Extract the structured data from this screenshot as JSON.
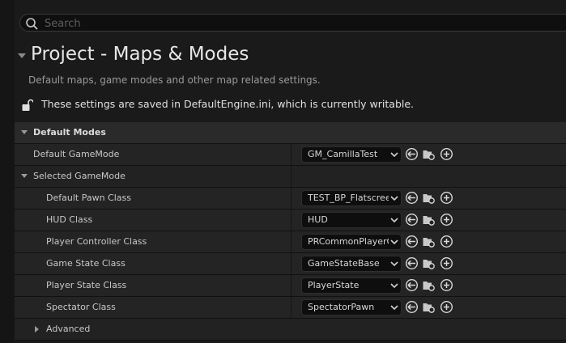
{
  "search": {
    "placeholder": "Search"
  },
  "header": {
    "title": "Project - Maps & Modes",
    "subtitle": "Default maps, game modes and other map related settings.",
    "config_notice": "These settings are saved in DefaultEngine.ini, which is currently writable."
  },
  "section": {
    "label": "Default Modes"
  },
  "default_gamemode": {
    "label": "Default GameMode",
    "value": "GM_CamillaTest"
  },
  "selected_gamemode": {
    "label": "Selected GameMode"
  },
  "properties": [
    {
      "label": "Default Pawn Class",
      "value": "TEST_BP_Flatscreen"
    },
    {
      "label": "HUD Class",
      "value": "HUD"
    },
    {
      "label": "Player Controller Class",
      "value": "PRCommonPlayerController"
    },
    {
      "label": "Game State Class",
      "value": "GameStateBase"
    },
    {
      "label": "Player State Class",
      "value": "PlayerState"
    },
    {
      "label": "Spectator Class",
      "value": "SpectatorPawn"
    }
  ],
  "advanced": {
    "label": "Advanced"
  },
  "icons": {
    "search": "search-icon",
    "lock": "unlocked-icon",
    "browse": "use-selected-icon",
    "folder": "browse-folder-icon",
    "add": "add-icon",
    "dropdown": "chevron-down-icon"
  }
}
